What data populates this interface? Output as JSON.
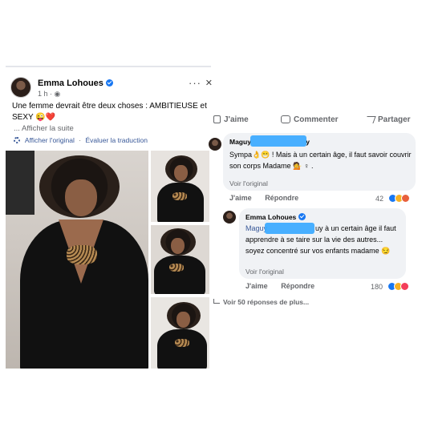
{
  "post": {
    "author": "Emma Lohoues",
    "time": "1 h",
    "text": "Une femme devrait être deux choses : AMBITIEUSE et SEXY 😜❤️",
    "see_more": "... Afficher la suite",
    "show_original": "Afficher l'original",
    "separator": "·",
    "rate_translation": "Évaluer la traduction",
    "more_icon": "ellipsis-icon",
    "close_icon": "close-icon"
  },
  "actions": {
    "like_label": "J'aime",
    "comment_label": "Commenter",
    "share_label": "Partager"
  },
  "comments": [
    {
      "author_visible": "Maguy",
      "author_tail": "y",
      "text": "Sympa👌😁 ! Mais à un certain âge, il faut savoir couvrir son corps Madame 💁 ♀ .",
      "see_original": "Voir l'original",
      "like_label": "J'aime",
      "reply_label": "Répondre",
      "reaction_count": "42"
    }
  ],
  "reply": {
    "author": "Emma Lohoues",
    "mention_visible": "Maguy",
    "text_after_mention": "uy à un certain âge il faut apprendre à se taire sur la vie des autres... soyez concentré sur vos enfants madame 😏",
    "see_original": "Voir l'original",
    "like_label": "J'aime",
    "reply_label": "Répondre",
    "reaction_count": "180"
  },
  "more_replies": "Voir 50 réponses de plus...",
  "colors": {
    "link": "#385898",
    "meta": "#65676b",
    "bubble": "#f0f2f5",
    "verified": "#1877f2",
    "redaction": "#3aa9ff"
  }
}
